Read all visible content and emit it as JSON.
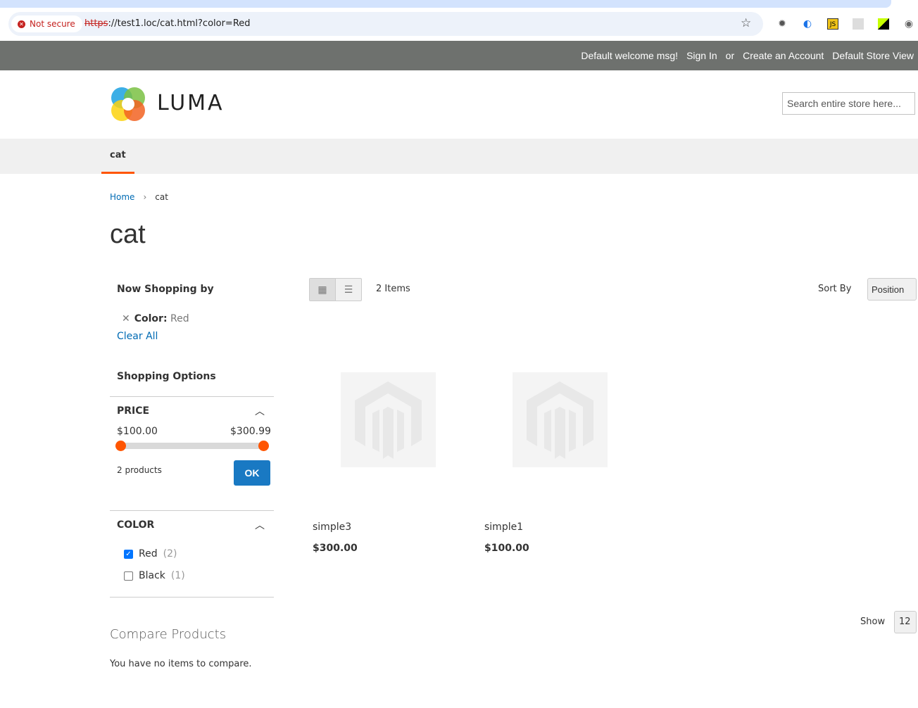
{
  "browser": {
    "security": "Not secure",
    "url_scheme": "https",
    "url_rest": "://test1.loc/cat.html?color=Red"
  },
  "header": {
    "welcome": "Default welcome msg!",
    "sign_in": "Sign In",
    "or": "or",
    "create_account": "Create an Account",
    "store_switch": "Default Store View",
    "logo_text": "LUMA",
    "search_placeholder": "Search entire store here..."
  },
  "nav": {
    "items": [
      {
        "label": "cat"
      }
    ]
  },
  "breadcrumb": {
    "home": "Home",
    "current": "cat"
  },
  "page_title": "cat",
  "sidebar": {
    "now_shopping": "Now Shopping by",
    "filter": {
      "label": "Color:",
      "value": "Red"
    },
    "clear_all": "Clear All",
    "shopping_options": "Shopping Options",
    "price": {
      "title": "PRICE",
      "min": "$100.00",
      "max": "$300.99",
      "count": "2 products",
      "ok": "OK"
    },
    "color": {
      "title": "COLOR",
      "options": [
        {
          "label": "Red",
          "count": "(2)",
          "checked": true
        },
        {
          "label": "Black",
          "count": "(1)",
          "checked": false
        }
      ]
    },
    "compare_title": "Compare Products",
    "compare_msg": "You have no items to compare."
  },
  "toolbar": {
    "items": "2 Items",
    "sort_label": "Sort By",
    "sort_value": "Position",
    "show_label": "Show",
    "show_value": "12"
  },
  "products": [
    {
      "name": "simple3",
      "price": "$300.00"
    },
    {
      "name": "simple1",
      "price": "$100.00"
    }
  ],
  "colors": {
    "accent": "#ff5501",
    "link": "#006bb4",
    "button": "#1979c3"
  }
}
